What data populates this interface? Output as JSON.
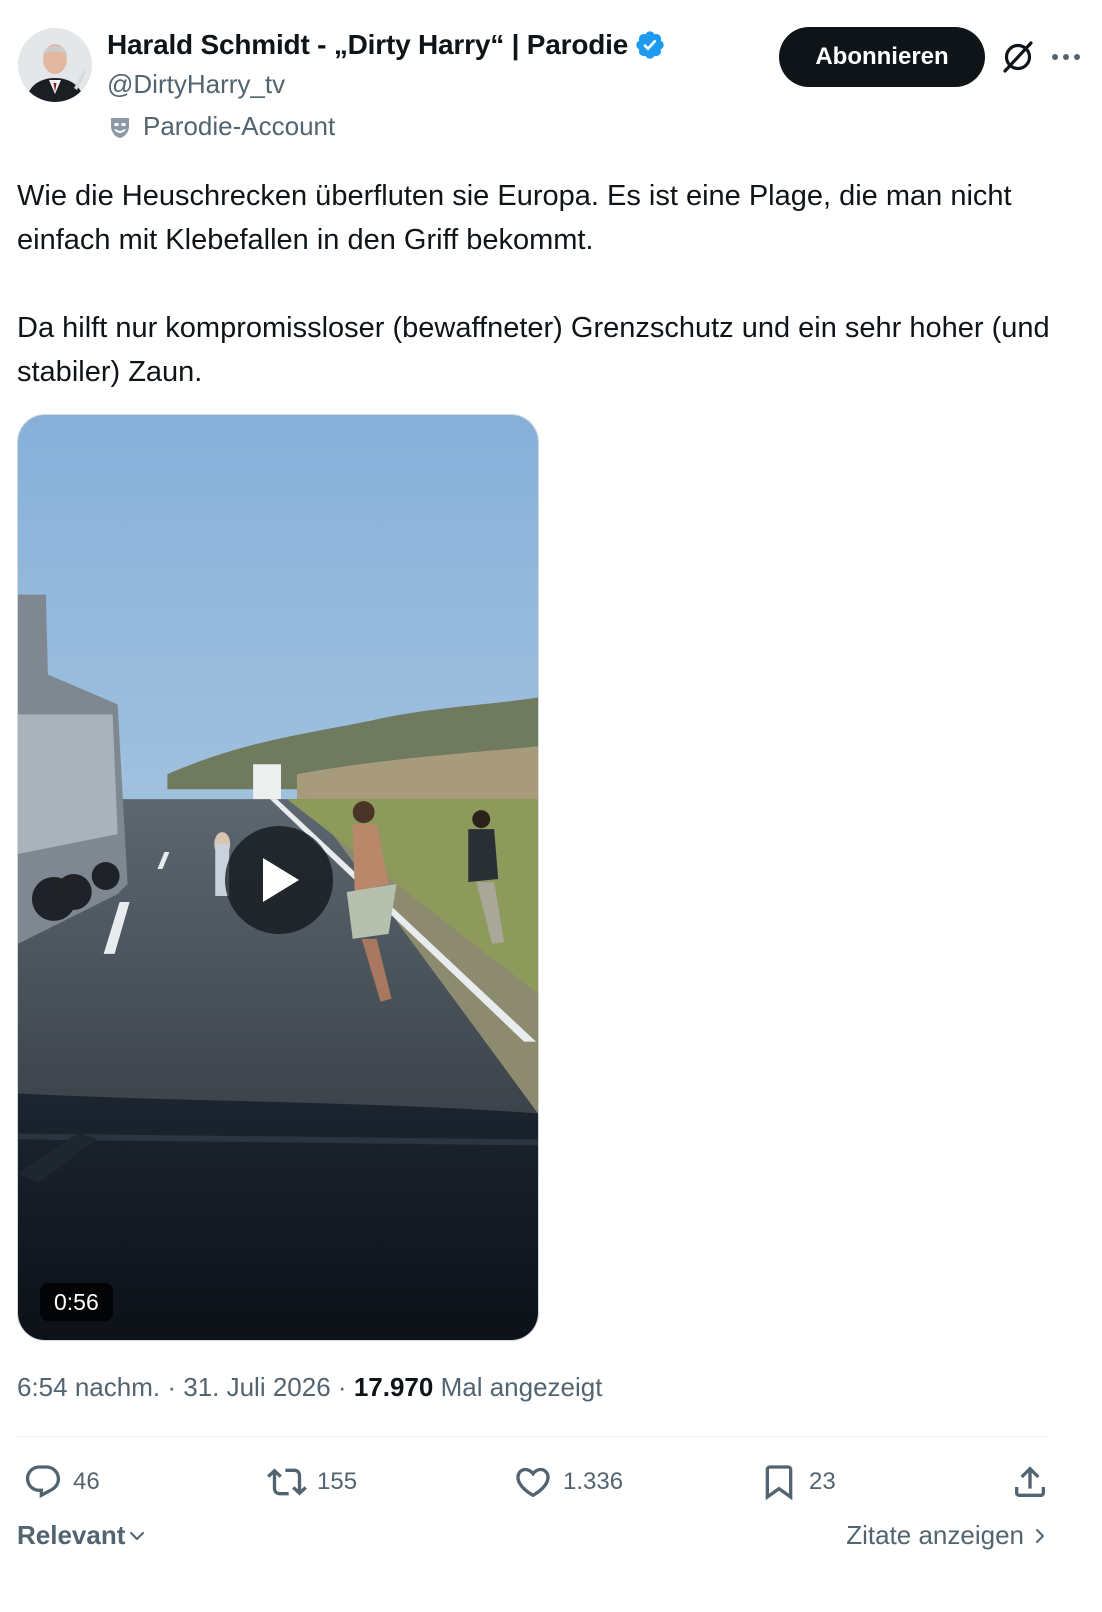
{
  "author": {
    "display_name": "Harald Schmidt - „Dirty Harry“ | Parodie",
    "handle": "@DirtyHarry_tv",
    "parody_label": "Parodie-Account",
    "verified": true
  },
  "header": {
    "subscribe_label": "Abonnieren",
    "icons": [
      "grok-icon",
      "more-icon"
    ]
  },
  "tweet": {
    "paragraphs": [
      "Wie die Heuschrecken überfluten sie Europa. Es ist eine Plage, die man nicht einfach mit Klebefallen in den Griff bekommt.",
      "Da hilft nur kompromissloser (bewaffneter) Grenzschutz und ein sehr hoher (und stabiler) Zaun."
    ]
  },
  "media": {
    "type": "video",
    "duration": "0:56"
  },
  "meta": {
    "time": "6:54 nachm.",
    "separator": "·",
    "date": "31. Juli 2026",
    "views_count": "17.970",
    "views_label": "Mal angezeigt"
  },
  "actions": {
    "replies": "46",
    "reposts": "155",
    "likes": "1.336",
    "bookmarks": "23"
  },
  "footer": {
    "sort_label": "Relevant",
    "quotes_label": "Zitate anzeigen"
  },
  "colors": {
    "text": "#0f1419",
    "secondary": "#536471",
    "verified_blue": "#1d9bf0",
    "divider": "#eff3f4"
  }
}
